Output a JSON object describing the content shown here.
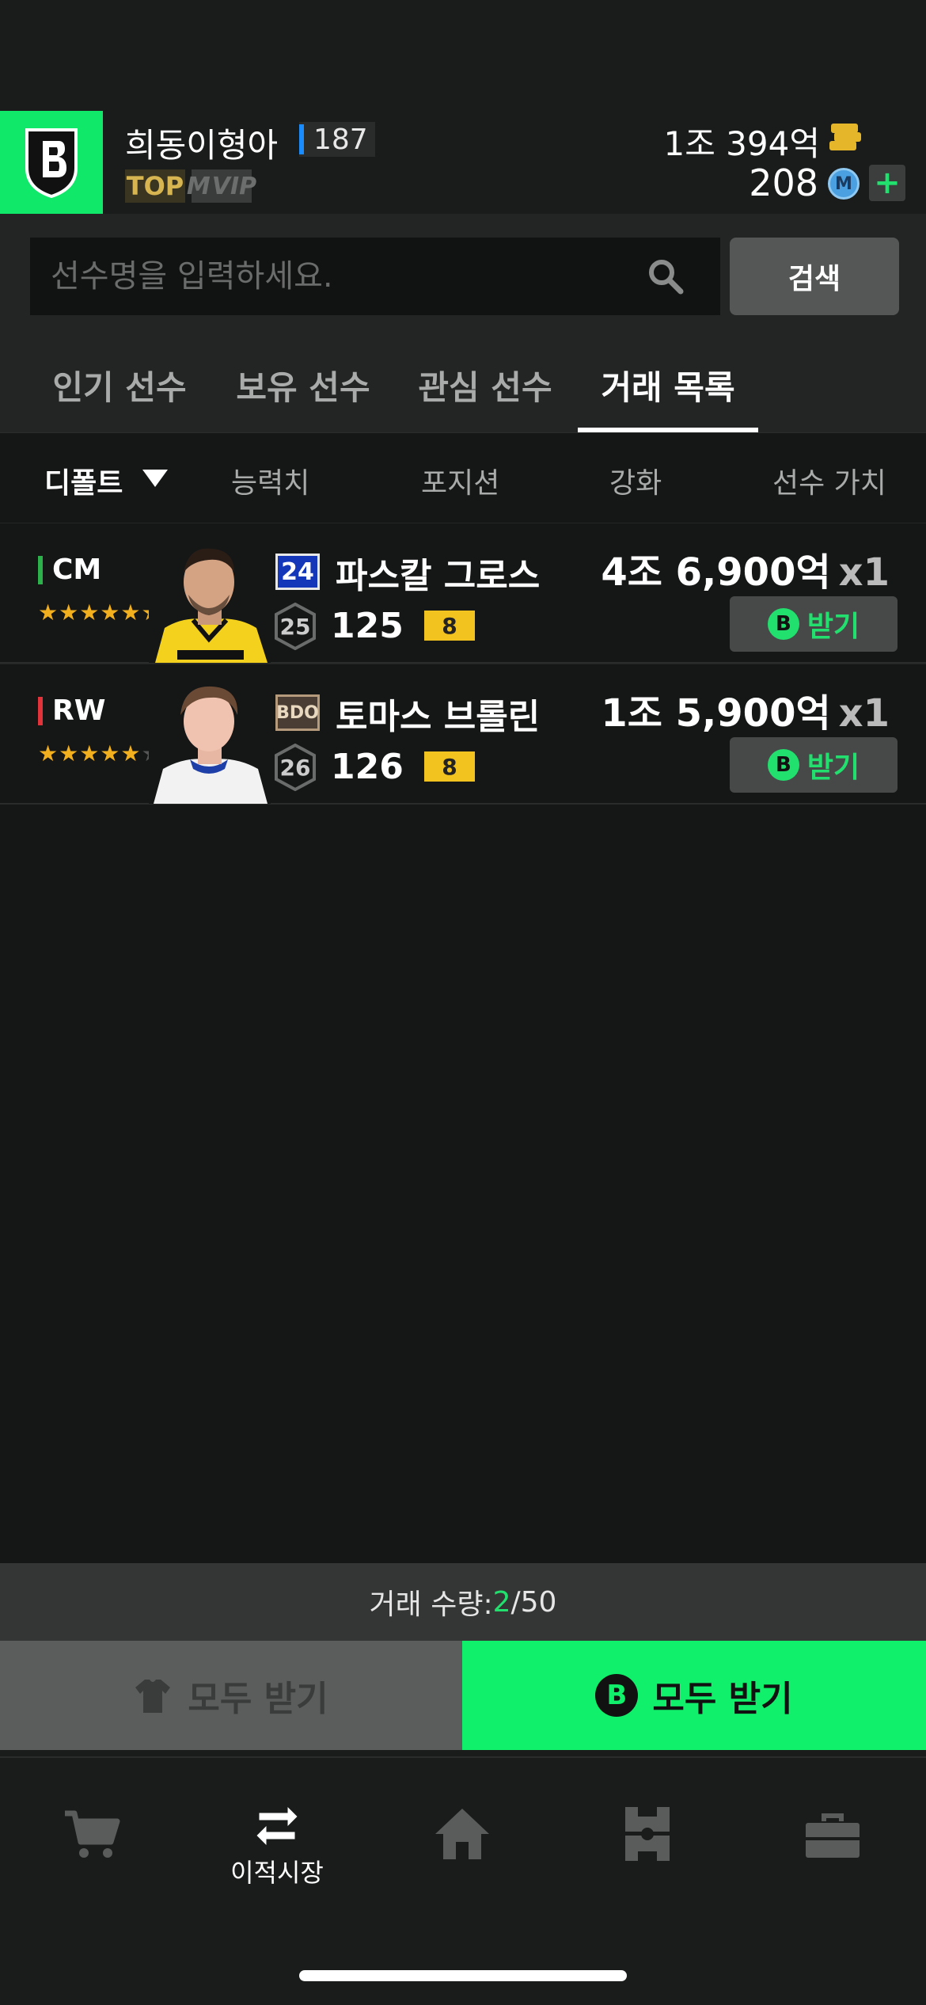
{
  "profile": {
    "nickname": "희동이형아",
    "level": "187",
    "tag_top": "TOP",
    "tag_vip": "VIP",
    "bp_amount": "1조 394억",
    "m_amount": "208",
    "m_icon_letter": "M"
  },
  "search": {
    "placeholder": "선수명을 입력하세요.",
    "button_label": "검색"
  },
  "tabs": [
    {
      "label": "인기 선수",
      "active": false
    },
    {
      "label": "보유 선수",
      "active": false
    },
    {
      "label": "관심 선수",
      "active": false
    },
    {
      "label": "거래 목록",
      "active": true
    }
  ],
  "sort": {
    "default_label": "디폴트",
    "ability_label": "능력치",
    "position_label": "포지션",
    "enhance_label": "강화",
    "value_label": "선수 가치"
  },
  "players": [
    {
      "position": "CM",
      "position_color": "#2db14a",
      "stars_filled": 6,
      "season": "24",
      "name": "파스칼 그로스",
      "hex_value": "25",
      "ovr": "125",
      "grade": "8",
      "price": "4조 6,900억",
      "qty": "x1",
      "receive_label": "받기",
      "b_letter": "B"
    },
    {
      "position": "RW",
      "position_color": "#e3333a",
      "stars_filled": 5,
      "season": "BDO",
      "name": "토마스 브롤린",
      "hex_value": "26",
      "ovr": "126",
      "grade": "8",
      "price": "1조 5,900억",
      "qty": "x1",
      "receive_label": "받기",
      "b_letter": "B"
    }
  ],
  "trade_count": {
    "label": "거래 수량: ",
    "current": "2",
    "max": "/50"
  },
  "bulk": {
    "left_label": "모두 받기",
    "right_label": "모두 받기",
    "b_letter": "B"
  },
  "bottom_nav": {
    "transfer_label": "이적시장"
  },
  "colors": {
    "accent_green": "#10f06a",
    "grade_yellow": "#f2c21e"
  }
}
